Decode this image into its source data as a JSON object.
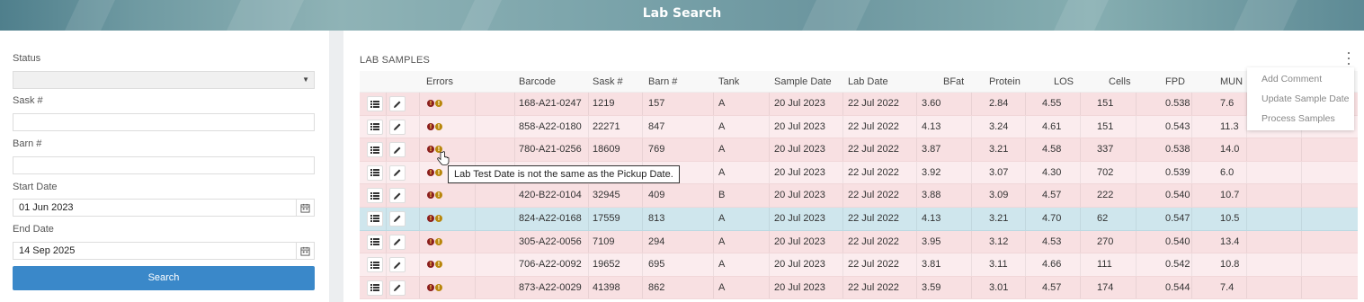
{
  "header": {
    "title": "Lab Search"
  },
  "filters": {
    "status_label": "Status",
    "status_value": "",
    "sask_label": "Sask #",
    "sask_value": "",
    "barn_label": "Barn #",
    "barn_value": "",
    "start_label": "Start Date",
    "start_value": "01 Jun 2023",
    "end_label": "End Date",
    "end_value": "14 Sep 2025",
    "search_label": "Search"
  },
  "samples": {
    "title": "LAB SAMPLES",
    "columns": [
      "Errors",
      "Barcode",
      "Sask #",
      "Barn #",
      "Tank",
      "Sample Date",
      "Lab Date",
      "BFat",
      "Protein",
      "LOS",
      "Cells",
      "FPD",
      "MUN"
    ],
    "rows": [
      [
        "168-A21-0247",
        "1219",
        "157",
        "A",
        "20 Jul 2023",
        "22 Jul 2022",
        "3.60",
        "2.84",
        "4.55",
        "151",
        "0.538",
        "7.6"
      ],
      [
        "858-A22-0180",
        "22271",
        "847",
        "A",
        "20 Jul 2023",
        "22 Jul 2022",
        "4.13",
        "3.24",
        "4.61",
        "151",
        "0.543",
        "11.3"
      ],
      [
        "780-A21-0256",
        "18609",
        "769",
        "A",
        "20 Jul 2023",
        "22 Jul 2022",
        "3.87",
        "3.21",
        "4.58",
        "337",
        "0.538",
        "14.0"
      ],
      [
        "",
        "",
        "",
        "A",
        "20 Jul 2023",
        "22 Jul 2022",
        "3.92",
        "3.07",
        "4.30",
        "702",
        "0.539",
        "6.0"
      ],
      [
        "420-B22-0104",
        "32945",
        "409",
        "B",
        "20 Jul 2023",
        "22 Jul 2022",
        "3.88",
        "3.09",
        "4.57",
        "222",
        "0.540",
        "10.7"
      ],
      [
        "824-A22-0168",
        "17559",
        "813",
        "A",
        "20 Jul 2023",
        "22 Jul 2022",
        "4.13",
        "3.21",
        "4.70",
        "62",
        "0.547",
        "10.5"
      ],
      [
        "305-A22-0056",
        "7109",
        "294",
        "A",
        "20 Jul 2023",
        "22 Jul 2022",
        "3.95",
        "3.12",
        "4.53",
        "270",
        "0.540",
        "13.4"
      ],
      [
        "706-A22-0092",
        "19652",
        "695",
        "A",
        "20 Jul 2023",
        "22 Jul 2022",
        "3.81",
        "3.11",
        "4.66",
        "111",
        "0.542",
        "10.8"
      ],
      [
        "873-A22-0029",
        "41398",
        "862",
        "A",
        "20 Jul 2023",
        "22 Jul 2022",
        "3.59",
        "3.01",
        "4.57",
        "174",
        "0.544",
        "7.4"
      ]
    ]
  },
  "tooltip": "Lab Test Date is not the same as the Pickup Date.",
  "menu": {
    "add_comment": "Add Comment",
    "update_sample_date": "Update Sample Date",
    "process_samples": "Process Samples"
  },
  "colors": {
    "accent": "#3a88c9",
    "row_error": "#f8e0e2",
    "row_selected": "#cfe6ed"
  }
}
